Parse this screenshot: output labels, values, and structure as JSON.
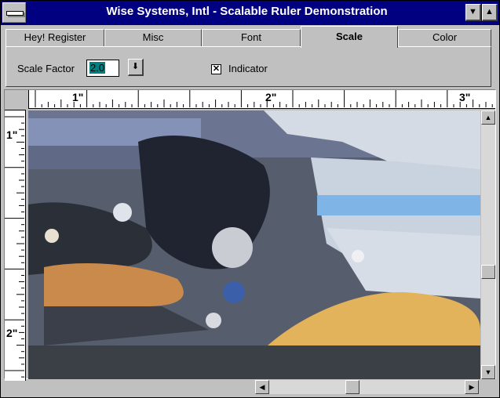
{
  "window": {
    "title": "Wise Systems, Intl - Scalable Ruler Demonstration",
    "sysmenu_icon": "system-menu-icon",
    "buttons": {
      "minimize_icon": "triangle-down-icon",
      "maximize_icon": "triangle-up-icon"
    }
  },
  "tabs": [
    {
      "label": "Hey! Register",
      "active": false
    },
    {
      "label": "Misc",
      "active": false
    },
    {
      "label": "Font",
      "active": false
    },
    {
      "label": "Scale",
      "active": true
    },
    {
      "label": "Color",
      "active": false
    }
  ],
  "scale_panel": {
    "factor_label": "Scale Factor",
    "factor_value": "2.0",
    "spin_icon": "arrow-down-bar-icon",
    "indicator_label": "Indicator",
    "indicator_checked": true
  },
  "rulers": {
    "horizontal_labels": [
      "1\"",
      "2\"",
      "3\""
    ],
    "vertical_labels": [
      "1\"",
      "2\""
    ]
  },
  "scroll": {
    "vertical_thumb_fraction": 0.62,
    "horizontal_thumb_fraction": 0.42
  },
  "colors": {
    "titlebar": "#000080",
    "face": "#c0c0c0",
    "selection": "#008080"
  }
}
